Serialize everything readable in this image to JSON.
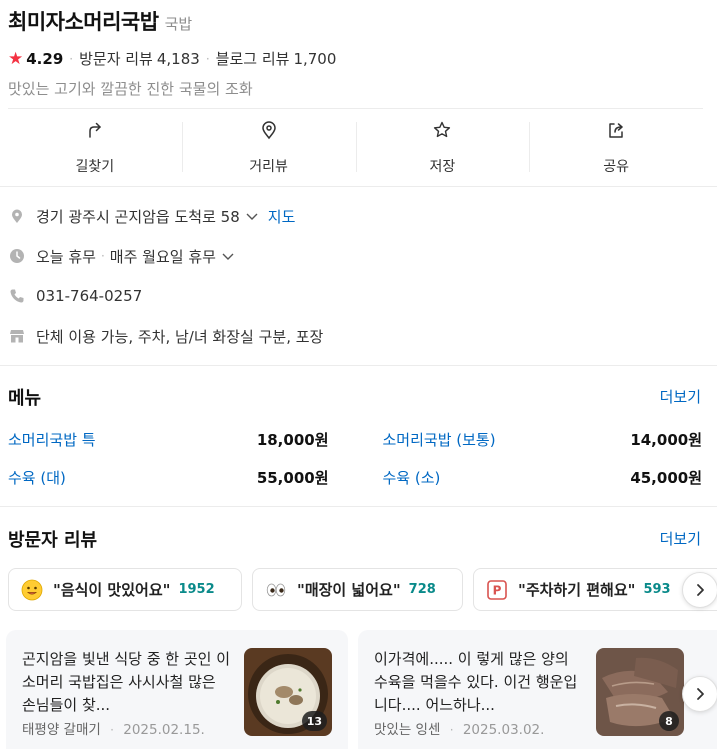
{
  "place": {
    "name": "최미자소머리국밥",
    "category": "국밥",
    "rating": "4.29",
    "visitor_review_label": "방문자 리뷰",
    "visitor_review_count": "4,183",
    "blog_review_label": "블로그 리뷰",
    "blog_review_count": "1,700",
    "description": "맛있는 고기와 깔끔한 진한 국물의 조화"
  },
  "actions": [
    {
      "label": "길찾기",
      "icon": "directions-icon"
    },
    {
      "label": "거리뷰",
      "icon": "location-pin-icon"
    },
    {
      "label": "저장",
      "icon": "star-outline-icon"
    },
    {
      "label": "공유",
      "icon": "share-icon"
    }
  ],
  "info": {
    "address": "경기 광주시 곤지암읍 도척로 58",
    "map_link": "지도",
    "hours_status": "오늘 휴무",
    "hours_detail": "매주 월요일 휴무",
    "phone": "031-764-0257",
    "amenities": "단체 이용 가능, 주차, 남/녀 화장실 구분, 포장"
  },
  "menu": {
    "title": "메뉴",
    "more": "더보기",
    "items": [
      {
        "name": "소머리국밥 특",
        "price": "18,000원"
      },
      {
        "name": "소머리국밥 (보통)",
        "price": "14,000원"
      },
      {
        "name": "수육 (대)",
        "price": "55,000원"
      },
      {
        "name": "수육 (소)",
        "price": "45,000원"
      }
    ]
  },
  "reviews": {
    "title": "방문자 리뷰",
    "more": "더보기",
    "keywords": [
      {
        "text": "\"음식이 맛있어요\"",
        "count": "1952",
        "emoji": "smile-emoji-icon"
      },
      {
        "text": "\"매장이 넓어요\"",
        "count": "728",
        "emoji": "eyes-emoji-icon"
      },
      {
        "text": "\"주차하기 편해요\"",
        "count": "593",
        "emoji": "parking-emoji-icon"
      }
    ],
    "cards": [
      {
        "text": "곤지암을 빛낸 식당 중 한 곳인 이 소머리 국밥집은 사시사철 많은 손님들이 찾...",
        "author": "태평양 갈매기",
        "date": "2025.02.15.",
        "photo_count": "13"
      },
      {
        "text": "이가격에..... 이 렇게 많은 양의 수육을 먹을수 있다. 이건 행운입니다.... 어느하나...",
        "author": "맛있는 잉센",
        "date": "2025.03.02.",
        "photo_count": "8"
      }
    ]
  },
  "colors": {
    "accent_link": "#0068c3",
    "star": "#f43142",
    "keyword_count": "#0a8a8a"
  }
}
